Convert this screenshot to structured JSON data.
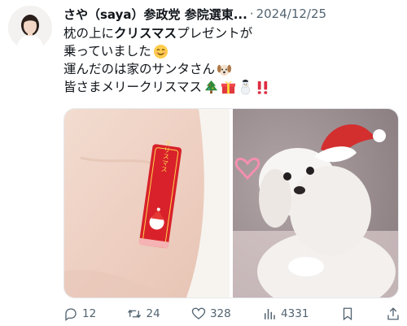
{
  "post": {
    "author_name": "さや（saya）参政党 参院選東...",
    "separator": "·",
    "date": "2024/12/25",
    "line1_pre": "枕の上に",
    "line1_bold": "クリスマス",
    "line1_post": "プレゼントが",
    "line2": "乗っていました",
    "line3": "運んだのは家のサンタさん",
    "line4": "皆さまメリークリスマス",
    "emoji": {
      "line2": "smiling-face-icon",
      "line3": "dog-face-icon",
      "line4": [
        "christmas-tree-icon",
        "gift-icon",
        "snowman-icon",
        "double-exclamation-icon"
      ]
    },
    "candy_wrapper_text": "クリスマス"
  },
  "actions": {
    "replies": "12",
    "reposts": "24",
    "likes": "328",
    "views": "4331"
  },
  "colors": {
    "text": "#0f1419",
    "secondary": "#536471",
    "wrapper_red": "#d8212a",
    "santa_hat_red": "#d32f2f"
  }
}
